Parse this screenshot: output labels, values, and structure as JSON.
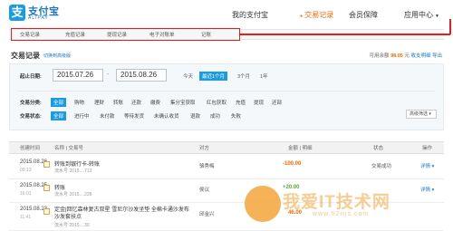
{
  "brand": {
    "logo_cn": "支付宝",
    "logo_en": "ALIPAY",
    "logo_mark": "支"
  },
  "topnav": [
    {
      "label": "我的支付宝",
      "active": false
    },
    {
      "label": "交易记录",
      "active": true
    },
    {
      "label": "会员保障",
      "active": false
    },
    {
      "label": "应用中心",
      "active": false
    }
  ],
  "subtabs": [
    "交易记录",
    "充值记录",
    "提现记录",
    "电子对账单",
    "记账"
  ],
  "section": {
    "title": "交易记录",
    "link": "切换到高级版"
  },
  "balance": {
    "label": "可用余额",
    "value": "98.05",
    "unit": "元",
    "links": [
      "收支明细",
      "导出"
    ]
  },
  "filter": {
    "date_label": "起止日期:",
    "start_date": "2015.07.26",
    "end_date": "2015.08.26",
    "ranges": [
      "今天",
      "最近1个月",
      "3个月",
      "1年"
    ],
    "active_range": "最近1个月",
    "category_label": "交易分类:",
    "categories": [
      "全部",
      "购物",
      "理财",
      "转账",
      "还款",
      "缴费",
      "集分宝获取",
      "红包获取",
      "充值",
      "提现",
      "还部"
    ],
    "status_label": "交易状态:",
    "statuses": [
      "全部",
      "进行中",
      "未付款",
      "等待发货",
      "未确认收货",
      "退款",
      "成功",
      "失败"
    ],
    "advanced_button": "高级筛选"
  },
  "table": {
    "headers": [
      "创建时间",
      "名称 | 交易号",
      "对方",
      "金额 | 明细",
      "状态",
      "操作"
    ],
    "rows": [
      {
        "date": "2015.08.26",
        "time": "09:13",
        "name": "转账到银行卡-转账",
        "sub": "流水号 2015....713",
        "party": "骆秀梅",
        "amount": "-100.00",
        "sign": "neg",
        "status": "交易成功",
        "action": "详情"
      },
      {
        "date": "2015.08.25",
        "time": "16:01",
        "name": "转账",
        "sub": "流水号 2015....228",
        "party": "侯议",
        "amount": "+20.00",
        "sign": "pos",
        "status": "",
        "action": "详情"
      },
      {
        "date": "2015.08.23",
        "time": "11:41",
        "name": "定金|回忆森林复古双星 雪尼尔沙发坐垫 全棉卡通沙发布 沙发套扶点",
        "sub": "流水号 2015....30",
        "party": "邱金兴",
        "amount": "46.00",
        "sign": "neg",
        "status": "",
        "action": ""
      }
    ]
  },
  "watermark": {
    "text": "我爱IT技术网",
    "url": "www.52itjs.com"
  }
}
